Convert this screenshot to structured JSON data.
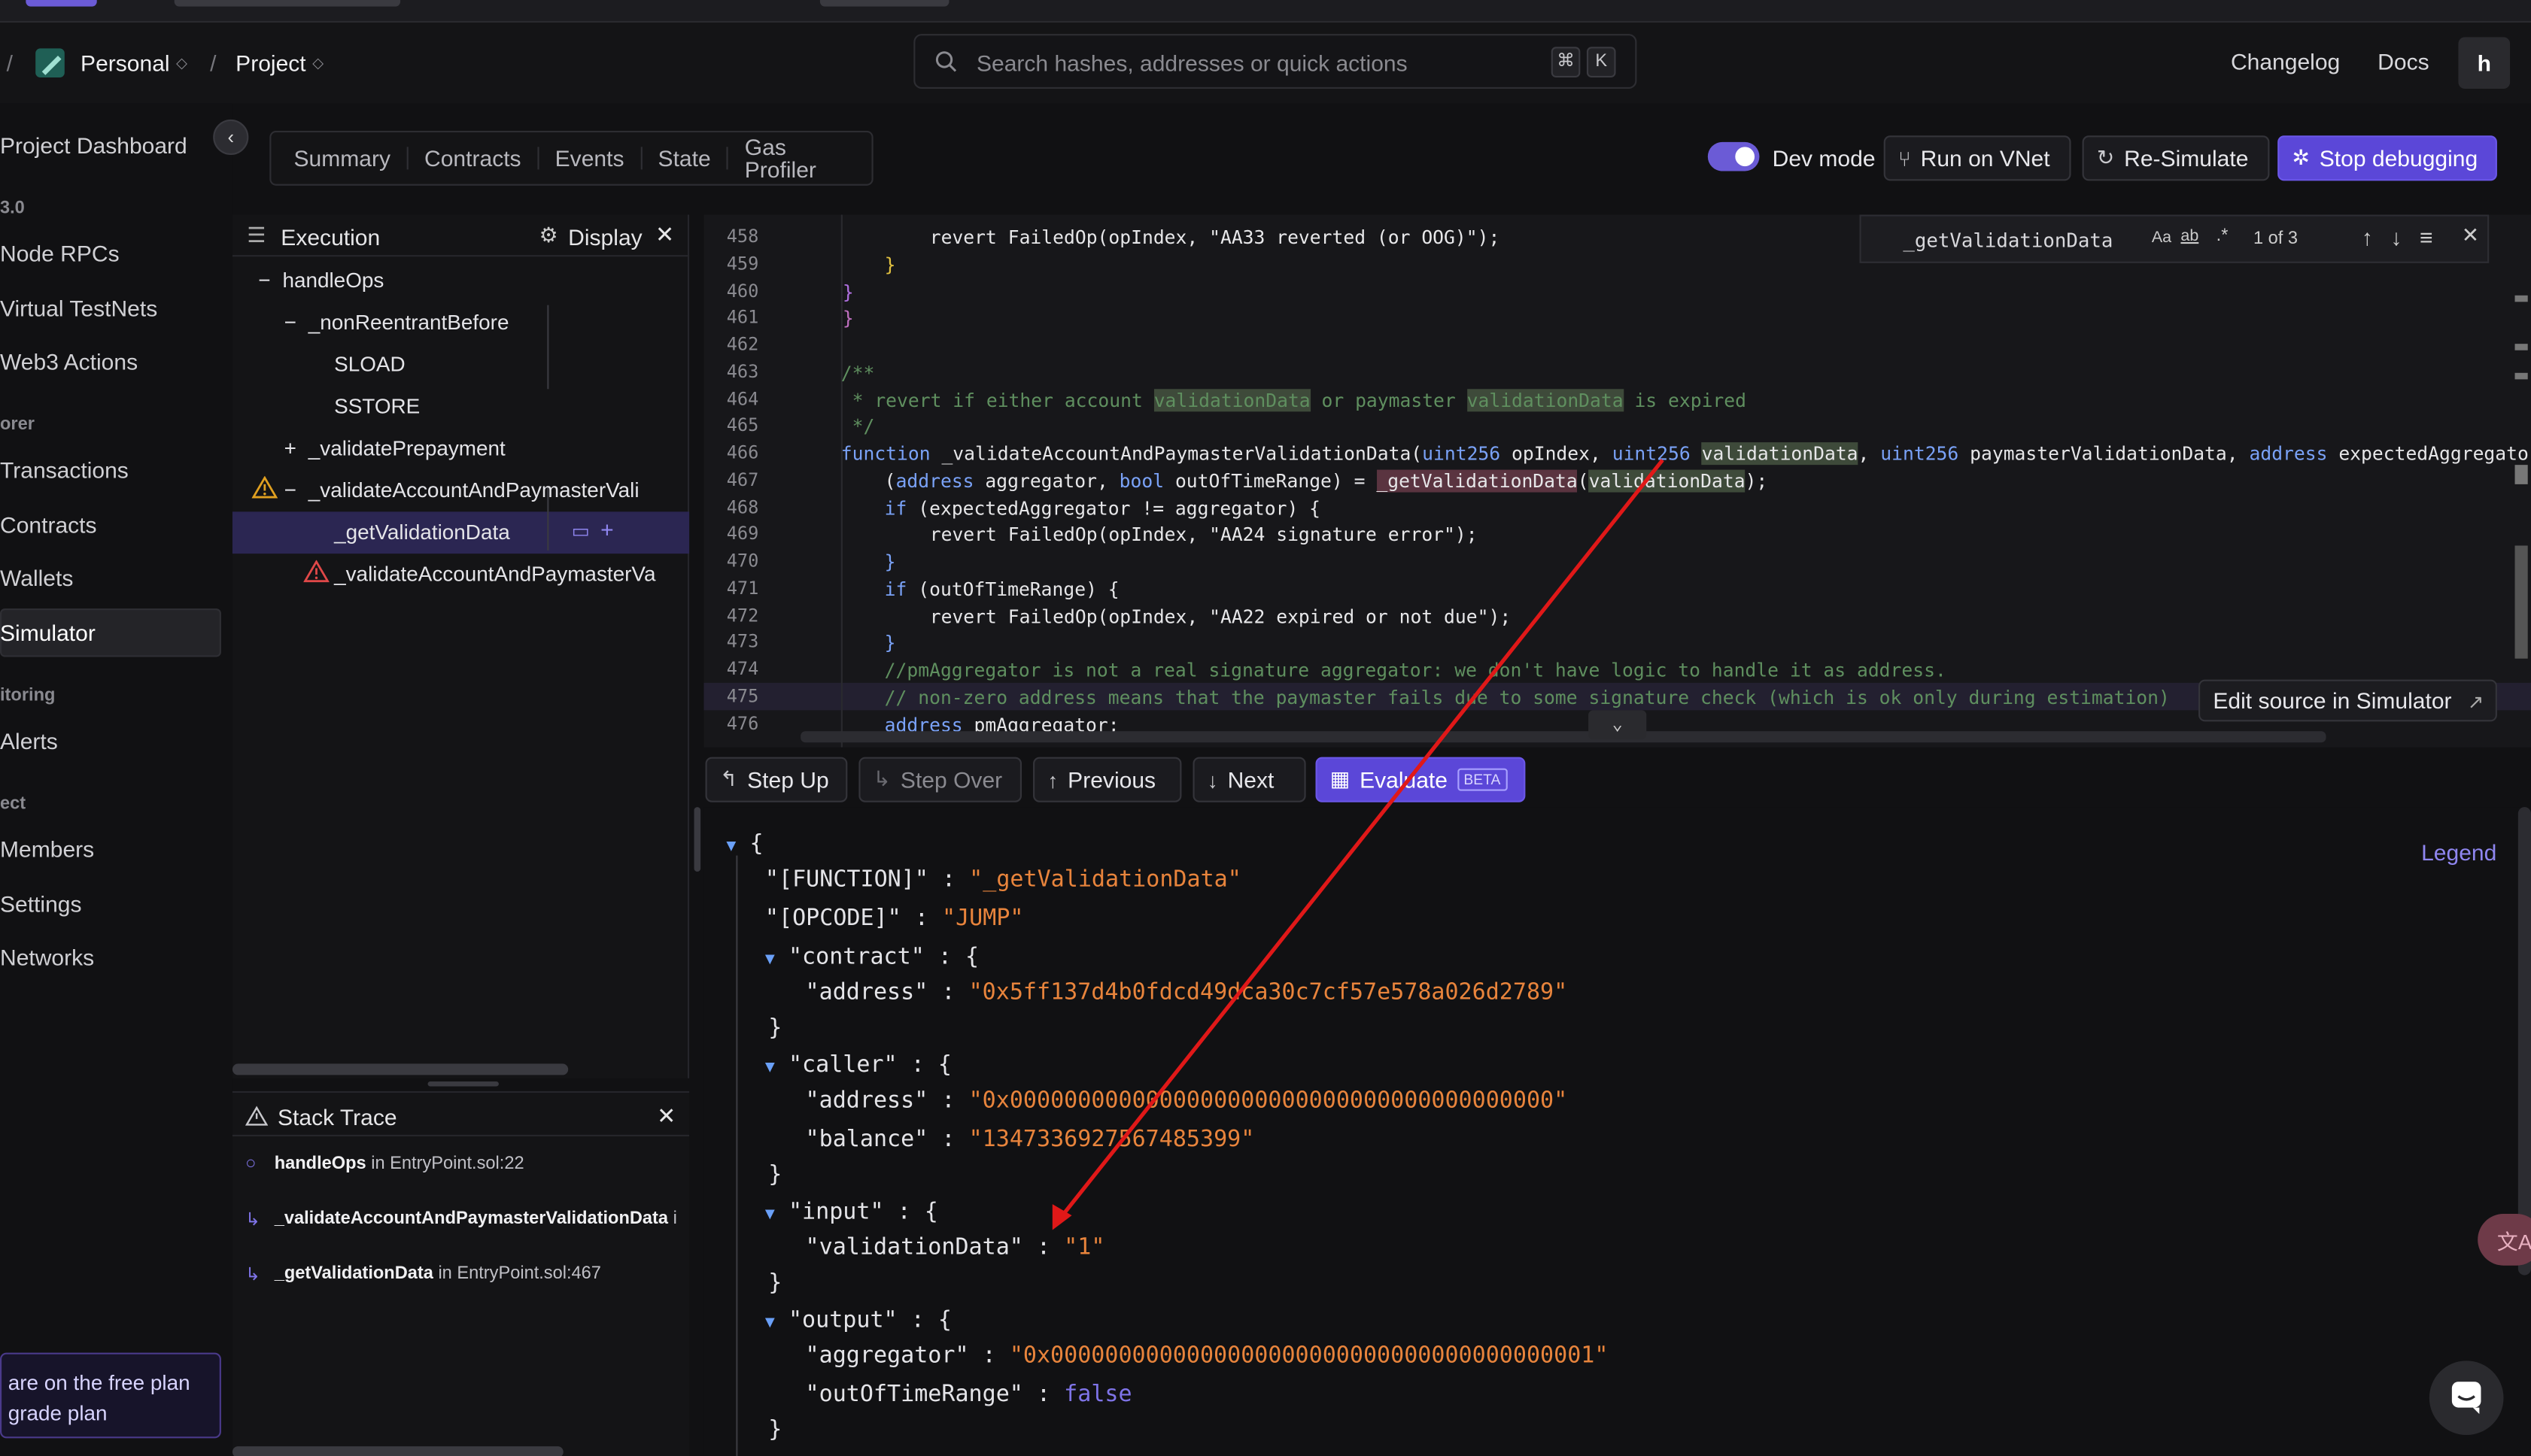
{
  "header": {
    "workspace": "Personal",
    "project": "Project",
    "search_placeholder": "Search hashes, addresses or quick actions",
    "kbd_cmd": "⌘",
    "kbd_k": "K",
    "changelog": "Changelog",
    "docs": "Docs",
    "avatar": "h"
  },
  "sidebar": {
    "items": [
      "Project Dashboard",
      "Node RPCs",
      "Virtual TestNets",
      "Web3 Actions",
      "Transactions",
      "Contracts",
      "Wallets",
      "Simulator",
      "Alerts",
      "Members",
      "Settings",
      "Networks"
    ],
    "sections": [
      "3.0",
      "orer",
      "itoring",
      "ect"
    ],
    "free_plan_line1": "are on the free plan",
    "free_plan_line2": "grade plan"
  },
  "tabs": [
    "Summary",
    "Contracts",
    "Events",
    "State",
    "Gas Profiler"
  ],
  "toolbar": {
    "dev_mode": "Dev mode",
    "run_vnet": "Run on VNet",
    "resimulate": "Re-Simulate",
    "stop_debugging": "Stop debugging"
  },
  "execution": {
    "title": "Execution",
    "display": "Display",
    "nodes": [
      "handleOps",
      "_nonReentrantBefore",
      "SLOAD",
      "SSTORE",
      "_validatePrepayment",
      "_validateAccountAndPaymasterVali",
      "_getValidationData",
      "_validateAccountAndPaymasterVa"
    ]
  },
  "stack_trace": {
    "title": "Stack Trace",
    "rows": [
      {
        "fn": "handleOps",
        "loc": "EntryPoint.sol:22"
      },
      {
        "fn": "_validateAccountAndPaymasterValidationData",
        "loc": "i"
      },
      {
        "fn": "_getValidationData",
        "loc": "EntryPoint.sol:467"
      }
    ],
    "in": "in"
  },
  "code": {
    "line_numbers": [
      "458",
      "459",
      "460",
      "461",
      "462",
      "463",
      "464",
      "465",
      "466",
      "467",
      "468",
      "469",
      "470",
      "471",
      "472",
      "473",
      "474",
      "475",
      "476"
    ],
    "find_query": "_getValidationData",
    "find_count": "1 of 3",
    "find_aa": "Aa",
    "find_ab": "ab",
    "find_re": ".*",
    "edit_source": "Edit source in Simulator"
  },
  "steps": {
    "step_up": "Step Up",
    "step_over": "Step Over",
    "previous": "Previous",
    "next": "Next",
    "evaluate": "Evaluate",
    "beta": "BETA"
  },
  "json": {
    "legend": "Legend",
    "function": "\"_getValidationData\"",
    "opcode": "\"JUMP\"",
    "contract_address": "\"0x5ff137d4b0fdcd49dca30c7cf57e578a026d2789\"",
    "caller_address": "\"0x0000000000000000000000000000000000000000\"",
    "caller_balance": "\"1347336927567485399\"",
    "input_validation": "\"1\"",
    "output_aggregator": "\"0x0000000000000000000000000000000000000001\"",
    "output_outoftime": "false"
  }
}
